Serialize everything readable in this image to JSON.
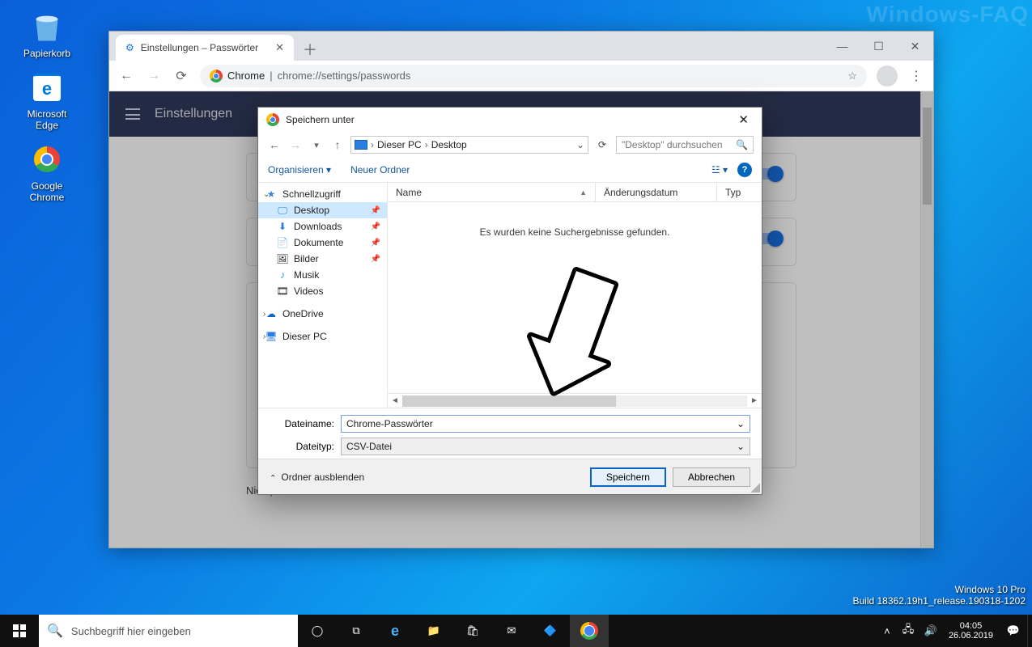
{
  "watermark": {
    "faq": "Windows-FAQ",
    "edition": "Windows 10 Pro",
    "build": "Build 18362.19h1_release.190318-1202"
  },
  "desktop": {
    "icons": [
      {
        "name": "recycle-bin",
        "label": "Papierkorb"
      },
      {
        "name": "edge",
        "label": "Microsoft Edge"
      },
      {
        "name": "chrome",
        "label": "Google Chrome"
      }
    ]
  },
  "taskbar": {
    "search_placeholder": "Suchbegriff hier eingeben",
    "clock_time": "04:05",
    "clock_date": "26.06.2019"
  },
  "chrome": {
    "tab_title": "Einstellungen – Passwörter",
    "addr_label": "Chrome",
    "addr_url": "chrome://settings/passwords",
    "settings_header": "Einstellungen",
    "truncated_row": "Nie speichern für"
  },
  "saveas": {
    "title": "Speichern unter",
    "breadcrumb": [
      "Dieser PC",
      "Desktop"
    ],
    "search_placeholder": "\"Desktop\" durchsuchen",
    "organize": "Organisieren",
    "new_folder": "Neuer Ordner",
    "columns": {
      "name": "Name",
      "date": "Änderungsdatum",
      "type": "Typ"
    },
    "empty_msg": "Es wurden keine Suchergebnisse gefunden.",
    "tree": {
      "quick": "Schnellzugriff",
      "desktop": "Desktop",
      "downloads": "Downloads",
      "documents": "Dokumente",
      "pictures": "Bilder",
      "music": "Musik",
      "videos": "Videos",
      "onedrive": "OneDrive",
      "thispc": "Dieser PC"
    },
    "filename_label": "Dateiname:",
    "filetype_label": "Dateityp:",
    "filename_value": "Chrome-Passwörter",
    "filetype_value": "CSV-Datei",
    "hide_folders": "Ordner ausblenden",
    "save": "Speichern",
    "cancel": "Abbrechen"
  }
}
